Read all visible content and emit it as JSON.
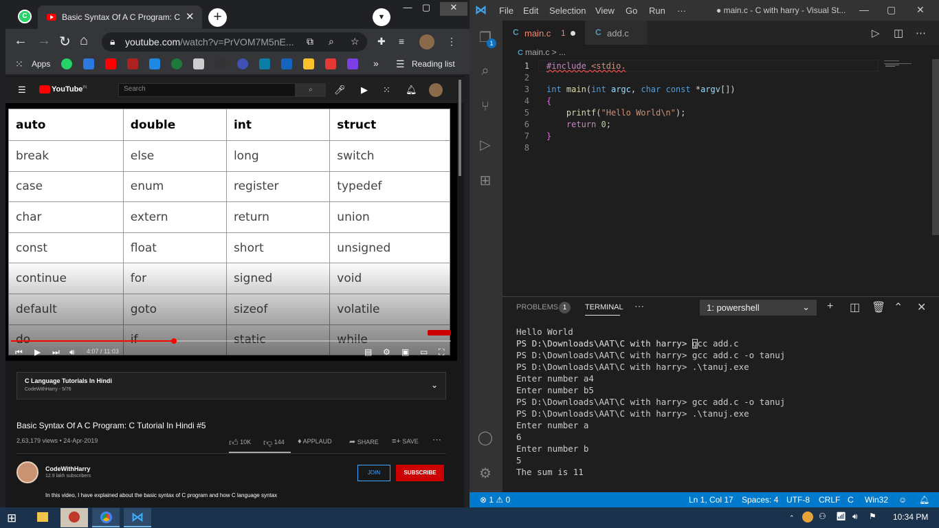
{
  "chrome": {
    "tab_title": "Basic Syntax Of A C Program: C T",
    "url_host": "youtube.com",
    "url_path": "/watch?v=PrVOM7M5nE...",
    "bookmarks_apps_label": "Apps",
    "reading_list_label": "Reading list"
  },
  "youtube": {
    "logo_text": "YouTube",
    "logo_region": "IN",
    "search_placeholder": "Search",
    "table_header": [
      "auto",
      "double",
      "int",
      "struct"
    ],
    "table_rows": [
      [
        "break",
        "else",
        "long",
        "switch"
      ],
      [
        "case",
        "enum",
        "register",
        "typedef"
      ],
      [
        "char",
        "extern",
        "return",
        "union"
      ],
      [
        "const",
        "float",
        "short",
        "unsigned"
      ],
      [
        "continue",
        "for",
        "signed",
        "void"
      ],
      [
        "default",
        "goto",
        "sizeof",
        "volatile"
      ],
      [
        "do",
        "if",
        "static",
        "while"
      ]
    ],
    "video_time": "4:07 / 11:03",
    "progress": 0.37,
    "playlist_title": "C Language Tutorials In Hindi",
    "playlist_sub": "CodeWithHarry - 5/76",
    "video_title": "Basic Syntax Of A C Program: C Tutorial In Hindi #5",
    "video_stats": "2,63,179 views • 24-Apr-2019",
    "likes": "10K",
    "dislikes": "144",
    "applaud": "APPLAUD",
    "share": "SHARE",
    "save": "SAVE",
    "channel_name": "CodeWithHarry",
    "channel_subs": "12.9 lakh subscribers",
    "join": "JOIN",
    "subscribe": "SUBSCRIBE",
    "description": "In this video, I have explained about the basic syntax of  C program and how C language syntax"
  },
  "vscode": {
    "menu": [
      "File",
      "Edit",
      "Selection",
      "View",
      "Go",
      "Run",
      "···"
    ],
    "window_title": "● main.c - C with harry - Visual St...",
    "tab_main": "main.c",
    "tab_main_problems": "1",
    "tab_add": "add.c",
    "breadcrumb": "main.c > ...",
    "code_lines": [
      "#include <stdio.",
      "",
      "int main(int argc, char const *argv[])",
      "{",
      "    printf(\"Hello World\\n\");",
      "    return 0;",
      "}",
      ""
    ],
    "panel_problems": "PROBLEMS",
    "panel_problems_count": "1",
    "panel_terminal": "TERMINAL",
    "shell": "1: powershell",
    "terminal_lines": [
      "Hello World",
      "PS D:\\Downloads\\AAT\\C with harry> gcc add.c",
      "PS D:\\Downloads\\AAT\\C with harry> gcc add.c -o tanuj",
      "PS D:\\Downloads\\AAT\\C with harry> .\\tanuj.exe",
      "Enter number a4",
      "Enter number b5",
      "PS D:\\Downloads\\AAT\\C with harry> gcc add.c -o tanuj",
      "PS D:\\Downloads\\AAT\\C with harry> .\\tanuj.exe",
      "Enter number a",
      "6",
      "Enter number b",
      "5",
      "The sum is 11"
    ],
    "terminal_prompt": "PS D:\\Downloads\\AAT\\C with harry> ",
    "status_errors": "⊗ 1 ⚠ 0",
    "status_position": "Ln 1, Col 17",
    "status_spaces": "Spaces: 4",
    "status_encoding": "UTF-8",
    "status_eol": "CRLF",
    "status_lang": "C",
    "status_platform": "Win32"
  },
  "taskbar": {
    "clock": "10:34 PM"
  },
  "colors": {
    "vscode_status": "#007acc",
    "youtube_red": "#ff0000",
    "taskbar": "#1b324d"
  }
}
